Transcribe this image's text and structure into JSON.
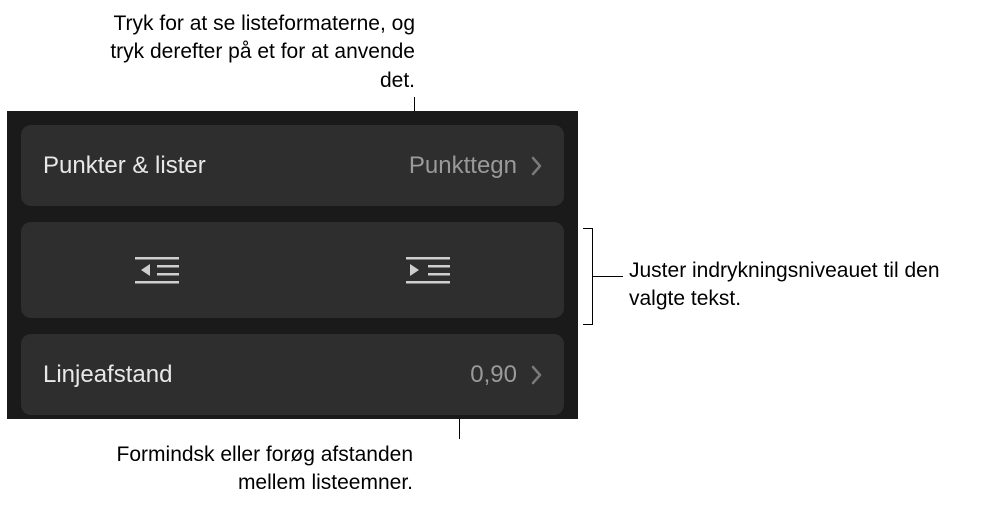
{
  "callouts": {
    "top": "Tryk for at se listeformaterne, og tryk derefter på et for at anvende det.",
    "right": "Juster indrykningsniveauet til den valgte tekst.",
    "bottom": "Formindsk eller forøg afstanden mellem listeemner."
  },
  "panel": {
    "bullets_lists": {
      "label": "Punkter & lister",
      "value": "Punkttegn"
    },
    "line_spacing": {
      "label": "Linjeafstand",
      "value": "0,90"
    }
  }
}
